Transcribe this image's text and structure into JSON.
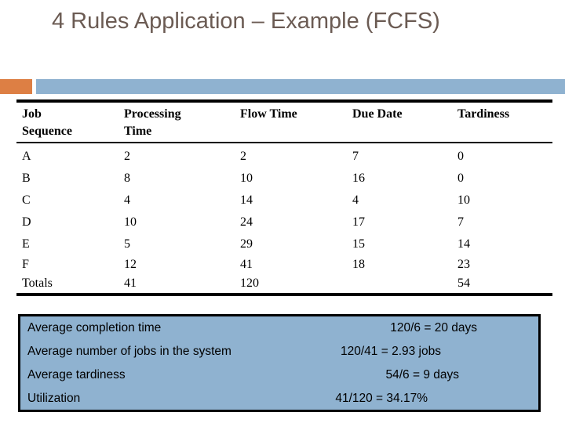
{
  "slide": {
    "title": "4 Rules Application – Example (FCFS)",
    "title_color": "#6b5b53",
    "accent_square_color": "#dd7f44",
    "accent_line_color": "#8fb2d0"
  },
  "table": {
    "headers": {
      "job_sequence": "Job Sequence",
      "job_sequence_line1": "Job",
      "job_sequence_line2": "Sequence",
      "processing_time": "Processing Time",
      "processing_time_line1": "Processing",
      "processing_time_line2": "Time",
      "flow_time": "Flow Time",
      "due_date": "Due Date",
      "tardiness": "Tardiness"
    },
    "rows": [
      {
        "job": "A",
        "processing": "2",
        "flow": "2",
        "due": "7",
        "tardiness": "0"
      },
      {
        "job": "B",
        "processing": "8",
        "flow": "10",
        "due": "16",
        "tardiness": "0"
      },
      {
        "job": "C",
        "processing": "4",
        "flow": "14",
        "due": "4",
        "tardiness": "10"
      },
      {
        "job": "D",
        "processing": "10",
        "flow": "24",
        "due": "17",
        "tardiness": "7"
      },
      {
        "job": "E",
        "processing": "5",
        "flow": "29",
        "due": "15",
        "tardiness": "14"
      },
      {
        "job": "F",
        "processing": "12",
        "flow": "41",
        "due": "18",
        "tardiness": "23"
      }
    ],
    "totals": {
      "job": "Totals",
      "processing": "41",
      "flow": "120",
      "due": "",
      "tardiness": "54"
    }
  },
  "summary": {
    "box_color": "#8fb2d0",
    "rows": [
      {
        "label": "Average completion time",
        "value": "120/6 = 20 days"
      },
      {
        "label": "Average number of jobs in the system",
        "value": "120/41 = 2.93 jobs"
      },
      {
        "label": "Average tardiness",
        "value": "54/6 = 9 days"
      },
      {
        "label": "Utilization",
        "value": "41/120 = 34.17%"
      }
    ]
  }
}
